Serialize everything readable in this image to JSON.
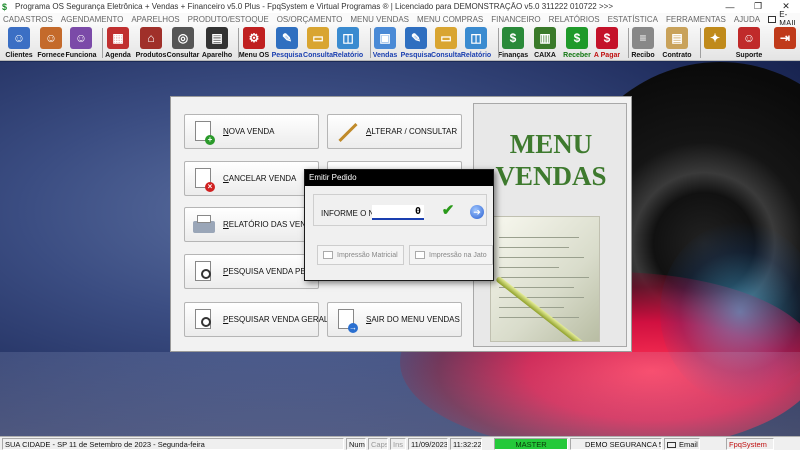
{
  "window": {
    "title": "Programa OS Segurança Eletrônica + Vendas + Financeiro v5.0 Plus - FpqSystem e Virtual Programas ® | Licenciado para  DEMONSTRAÇÃO v5.0 311222 010722 >>>",
    "minimize": "—",
    "maximize": "❐",
    "close": "✕"
  },
  "menubar": {
    "items": [
      "CADASTROS",
      "AGENDAMENTO",
      "APARELHOS",
      "PRODUTO/ESTOQUE",
      "OS/ORÇAMENTO",
      "MENU VENDAS",
      "MENU COMPRAS",
      "FINANCEIRO",
      "RELATÓRIOS",
      "ESTATÍSTICA",
      "FERRAMENTAS",
      "AJUDA"
    ],
    "email_label": "E-MAIL"
  },
  "toolbar": {
    "buttons": [
      {
        "label": "Clientes",
        "icon": "clients-icon",
        "color": "#3b6fc4"
      },
      {
        "label": "Fornece",
        "icon": "supplier-icon",
        "color": "#c46a2b"
      },
      {
        "label": "Funciona",
        "icon": "employee-icon",
        "color": "#7b4aa8"
      },
      {
        "label": "Agenda",
        "icon": "calendar-icon",
        "color": "#c03030"
      },
      {
        "label": "Produtos",
        "icon": "products-icon",
        "color": "#a0302a"
      },
      {
        "label": "Consultar",
        "icon": "safe-icon",
        "color": "#555555"
      },
      {
        "label": "Aparelho",
        "icon": "device-icon",
        "color": "#333333"
      },
      {
        "label": "Menu OS",
        "icon": "os-icon",
        "color": "#c02020"
      },
      {
        "label": "Pesquisa",
        "icon": "search-doc-icon",
        "color": "#2f6fc0"
      },
      {
        "label": "Consulta",
        "icon": "folder-icon",
        "color": "#d9a531"
      },
      {
        "label": "Relatório",
        "icon": "report-icon",
        "color": "#3a8bd0"
      },
      {
        "label": "Vendas",
        "icon": "monitor-icon",
        "color": "#4a8ad6"
      },
      {
        "label": "Pesquisa",
        "icon": "search-doc-icon",
        "color": "#2f6fc0"
      },
      {
        "label": "Consulta",
        "icon": "folder-icon",
        "color": "#d9a531"
      },
      {
        "label": "Relatório",
        "icon": "report-icon",
        "color": "#3a8bd0"
      },
      {
        "label": "Finanças",
        "icon": "finance-icon",
        "color": "#2a8a3a"
      },
      {
        "label": "CAIXA",
        "icon": "cashier-icon",
        "color": "#3a7a2a"
      },
      {
        "label": "Receber",
        "icon": "receive-money-icon",
        "color": "#1f9a2a"
      },
      {
        "label": "A Pagar",
        "icon": "pay-money-icon",
        "color": "#c4122a"
      },
      {
        "label": "Recibo",
        "icon": "receipt-icon",
        "color": "#888888"
      },
      {
        "label": "Contrato",
        "icon": "contract-icon",
        "color": "#c9a25a"
      },
      {
        "label": "",
        "icon": "tools-icon",
        "color": "#c08a1a"
      },
      {
        "label": "Suporte",
        "icon": "support-icon",
        "color": "#c02a2a"
      },
      {
        "label": "",
        "icon": "exit-icon",
        "color": "#c03a1a"
      }
    ]
  },
  "vendas": {
    "buttons": [
      {
        "label": "NOVA VENDA",
        "underline": "N",
        "rest": "OVA VENDA"
      },
      {
        "label": "ALTERAR / CONSULTAR",
        "underline": "A",
        "rest": "LTERAR / CONSULTAR"
      },
      {
        "label": "CANCELAR VENDA",
        "underline": "C",
        "rest": "ANCELAR VENDA"
      },
      {
        "label": "RELATÓRIO DAS VENDAS",
        "underline": "R",
        "rest": "ELATÓRIO DAS VENDAS"
      },
      {
        "label": "PESQUISA VENDA PENDENTE",
        "underline": "P",
        "rest": "ESQUISA VENDA PENDENTE"
      },
      {
        "label": "PESQUISAR VENDA GERAL",
        "underline": "P",
        "rest": "ESQUISAR VENDA GERAL"
      },
      {
        "label": "SAIR DO MENU VENDAS",
        "underline": "S",
        "rest": "AIR DO MENU VENDAS"
      }
    ],
    "panel_title_line1": "MENU",
    "panel_title_line2": "VENDAS"
  },
  "dialog": {
    "title": "Emitir Pedido",
    "input_label": "INFORME O Nº",
    "input_value": "0",
    "print_matrix": "Impressão Matricial",
    "print_inkjet": "Impressão na Jato"
  },
  "statusbar": {
    "city_date": "SUA CIDADE - SP 11 de Setembro de 2023 - Segunda-feira",
    "num": "Num",
    "caps": "Caps",
    "ins": "Ins",
    "date": "11/09/2023",
    "time": "11:32:22",
    "user": "MASTER",
    "company": "DEMO SEGURANCA 5.0",
    "email": "Email",
    "brand": "FpqSystem"
  }
}
